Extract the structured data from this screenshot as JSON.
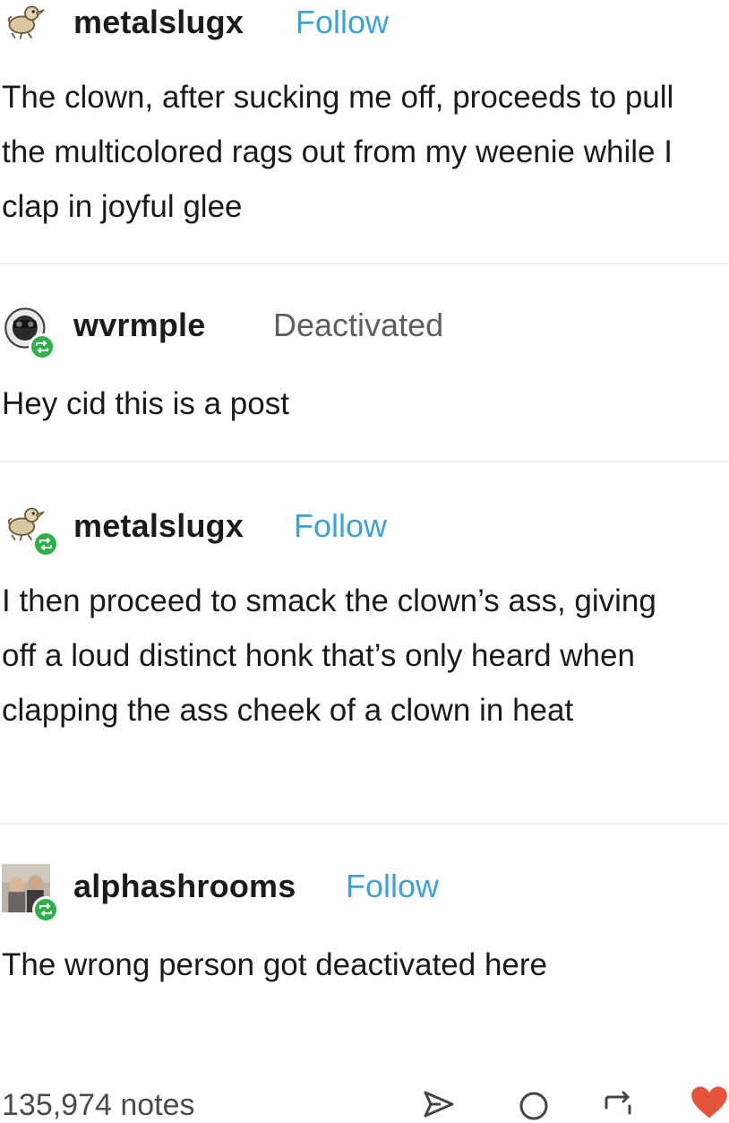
{
  "posts": [
    {
      "username": "metalslugx",
      "action_label": "Follow",
      "body": "The clown, after sucking me off, proceeds to pull the multicolored rags out from my weenie while I clap in joyful glee"
    },
    {
      "username": "wvrmple",
      "action_label": "Deactivated",
      "body": "Hey cid this is a post"
    },
    {
      "username": "metalslugx",
      "action_label": "Follow",
      "body": "I then proceed to smack the clown’s ass, giving off a loud distinct honk that’s only heard when clapping the ass cheek of a clown in heat"
    },
    {
      "username": "alphashrooms",
      "action_label": "Follow",
      "body": "The wrong person got deactivated here"
    }
  ],
  "footer": {
    "notes_label": "135,974 notes",
    "icons": [
      "share-icon",
      "reply-icon",
      "reblog-icon",
      "like-icon"
    ]
  },
  "colors": {
    "follow": "#3ba3d8",
    "reblog_badge": "#2db24a",
    "like": "#e5533a",
    "divider": "#ececec"
  }
}
